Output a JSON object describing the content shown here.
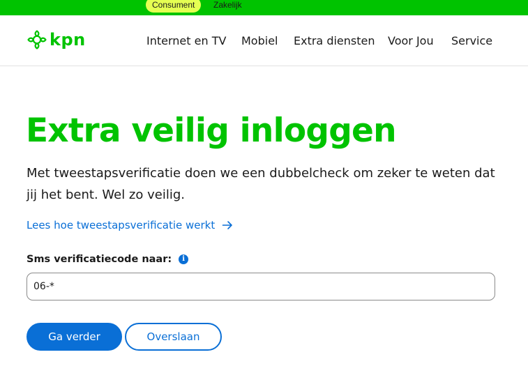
{
  "segment_bar": {
    "active": "Consument",
    "other": "Zakelijk"
  },
  "header": {
    "logo_text": "kpn",
    "nav": [
      "Internet en TV",
      "Mobiel",
      "Extra diensten",
      "Voor Jou",
      "Service"
    ]
  },
  "main": {
    "title": "Extra veilig inloggen",
    "intro": "Met tweestapsverificatie doen we een dubbelcheck om zeker te weten dat jij het bent. Wel zo veilig.",
    "link_label": "Lees hoe tweestapsverificatie werkt",
    "field_label": "Sms verificatiecode naar:",
    "info_glyph": "i",
    "phone_value": "06-*",
    "primary_button": "Ga verder",
    "secondary_button": "Overslaan"
  },
  "colors": {
    "brand_green": "#00c300",
    "segment_highlight": "#e5ff52",
    "link_blue": "#0a6fd6"
  },
  "icons": {
    "logo": "kpn-crown-icon",
    "link_arrow": "arrow-right-icon",
    "info": "info-icon"
  }
}
